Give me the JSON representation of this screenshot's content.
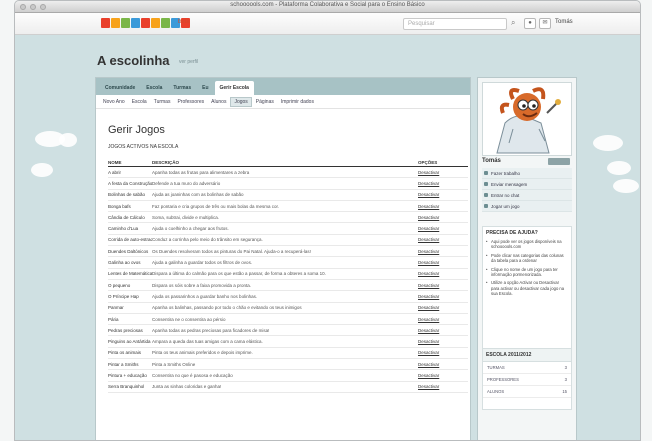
{
  "window": {
    "title": "schoooools.com - Plataforma Colaborativa e Social para o Ensino Básico"
  },
  "topbar": {
    "beta": "beta",
    "search_placeholder": "Pesquisar",
    "user": "Tomás",
    "logo_colors": [
      "#e9402b",
      "#f7a21b",
      "#7ab648",
      "#3b9ad9",
      "#e9402b",
      "#f7a21b",
      "#7ab648",
      "#3b9ad9",
      "#e9402b"
    ]
  },
  "page": {
    "title": "A escolinha",
    "title_link": "ver perfil"
  },
  "tabs": [
    {
      "label": "Comunidade",
      "active": false
    },
    {
      "label": "Escola",
      "active": false
    },
    {
      "label": "Turmas",
      "active": false
    },
    {
      "label": "Eu",
      "active": false
    },
    {
      "label": "Gerir Escola",
      "active": true
    }
  ],
  "subtabs": [
    {
      "label": "Novo Ano",
      "active": false
    },
    {
      "label": "Escola",
      "active": false
    },
    {
      "label": "Turmas",
      "active": false
    },
    {
      "label": "Professores",
      "active": false
    },
    {
      "label": "Alunos",
      "active": false
    },
    {
      "label": "Jogos",
      "active": true
    },
    {
      "label": "Páginas",
      "active": false
    },
    {
      "label": "Imprimir dados",
      "active": false
    }
  ],
  "content": {
    "title": "Gerir Jogos",
    "section": "JOGOS ACTIVOS NA ESCOLA",
    "columns": {
      "name": "NOME",
      "desc": "DESCRIÇÃO",
      "opt": "OPÇÕES"
    },
    "rows": [
      {
        "name": "A abrir",
        "desc": "Apanha todas as frutas para alimentares a zebra",
        "opt": "Desactivar"
      },
      {
        "name": "A festa da Construção",
        "desc": "Defende a tua muro do adversário",
        "opt": "Desactivar"
      },
      {
        "name": "Bolinhas de sabão",
        "desc": "Ajuda as joaninhas com as bolinhas de sabão",
        "opt": "Desactivar"
      },
      {
        "name": "Bonga bafs",
        "desc": "Faz pontaria e cria grupos de três ou mais bolas da mesma cor.",
        "opt": "Desactivar"
      },
      {
        "name": "Cândia de Cálculo",
        "desc": "Soma, subtrai, divide e multiplica.",
        "opt": "Desactivar"
      },
      {
        "name": "Caminho d'Lua",
        "desc": "Ajuda o coelhinho a chegar aos frutos.",
        "opt": "Desactivar"
      },
      {
        "name": "Corrida de auto-estrada",
        "desc": "Conduz a corrinha pelo meio do trânsito em segurança.",
        "opt": "Desactivar"
      },
      {
        "name": "Duendes Daltónicos",
        "desc": "Os Duendes resolveram todos as pinturas do Pai Natal. Ajuda-o a recuperá-las!",
        "opt": "Desactivar"
      },
      {
        "name": "Galinha ao ovos",
        "desc": "Ajuda a galinha a guardar todos os filtros de ovos.",
        "opt": "Desactivar"
      },
      {
        "name": "Lentes de Matemática",
        "desc": "Dispara a última do calmão para os que estão a passar, de forma a obteres a soma 10.",
        "opt": "Desactivar"
      },
      {
        "name": "O pequeno",
        "desc": "Dispara os sóis sobre a faixa promovida a pronta.",
        "opt": "Desactivar"
      },
      {
        "name": "O Príncipe Hap",
        "desc": "Ajuda os passarinhos a guardar banho nos bolinhas.",
        "opt": "Desactivar"
      },
      {
        "name": "Panmar",
        "desc": "Apanha os balinhas, passando por todo o chão e evitando os teus inimigos",
        "opt": "Desactivar"
      },
      {
        "name": "Pária",
        "desc": "Consentira ne o consentira ao pérsio",
        "opt": "Desactivar"
      },
      {
        "name": "Pedras preciosas",
        "desc": "Apanha todas as pedras preciosas para ficadores de misa!",
        "opt": "Desactivar"
      },
      {
        "name": "Pinguins ao Antártida",
        "desc": "Ampara a queda das tuas amigas com a cama elástica.",
        "opt": "Desactivar"
      },
      {
        "name": "Pinta os animais",
        "desc": "Pinta os teus animais preferidos e depois imprime.",
        "opt": "Desactivar"
      },
      {
        "name": "Pintar a Smiths",
        "desc": "Pinta a Smiths Online",
        "opt": "Desactivar"
      },
      {
        "name": "Pintura + educação",
        "desc": "Consentira no que é pasosa e educação",
        "opt": "Desactivar"
      },
      {
        "name": "Serra Branquinhol",
        "desc": "Junta as sinhas coloridas e ganha!",
        "opt": "Desactivar"
      }
    ]
  },
  "sidebar": {
    "name": "Tomás",
    "actions": [
      "Fazer trabalho",
      "Enviar mensagem",
      "Entrar no chat",
      "Jogar um jogo"
    ],
    "help_title": "PRECISA DE AJUDA?",
    "help_items": [
      "Aqui pode ver os jogos disponíveis na schoooools.com",
      "Pode clicar nas categorias das colunas da tabela para a ordenar",
      "Clique no nome de um jogo para ter informação pormenorizada.",
      "Utilize a opção Activar ou Desactivar para activar ou desactivar cada jogo na sua Escola."
    ],
    "school_title": "ESCOLA 2011/2012",
    "stats": [
      {
        "label": "TURMAS",
        "value": "3"
      },
      {
        "label": "PROFESSORES",
        "value": "3"
      },
      {
        "label": "ALUNOS",
        "value": "15"
      }
    ]
  }
}
